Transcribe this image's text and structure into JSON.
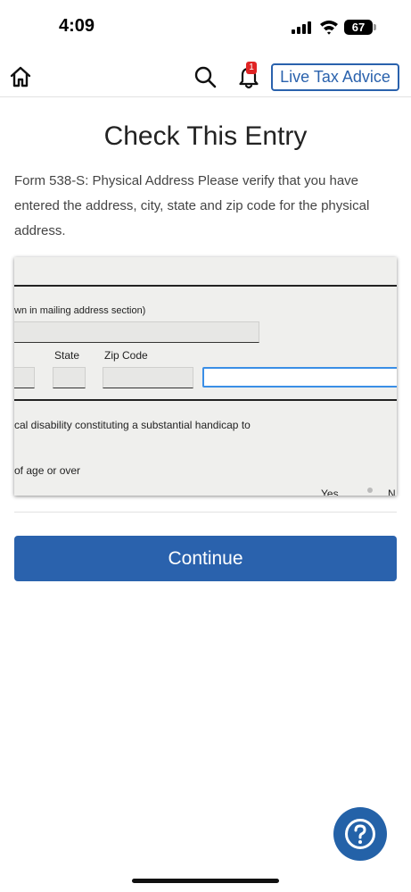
{
  "status_bar": {
    "time": "4:09",
    "battery": "67"
  },
  "nav": {
    "notification_count": "1",
    "live_advice_label": "Live Tax Advice"
  },
  "page": {
    "title": "Check This Entry",
    "description": "Form 538-S: Physical Address Please verify that you have entered the address, city, state and zip code for the physical address."
  },
  "form_preview": {
    "mailing_note": "wn in mailing address section)",
    "state_label": "State",
    "zip_label": "Zip Code",
    "disability_text": "cal disability constituting a substantial handicap to",
    "age_text": "of age or over",
    "yes_label": "Yes",
    "no_label": "N"
  },
  "actions": {
    "continue_label": "Continue"
  },
  "colors": {
    "accent": "#2a62ad",
    "badge": "#e02424",
    "active_field": "#3a8ee6"
  },
  "icons": [
    "home-icon",
    "search-icon",
    "bell-icon",
    "help-icon"
  ]
}
